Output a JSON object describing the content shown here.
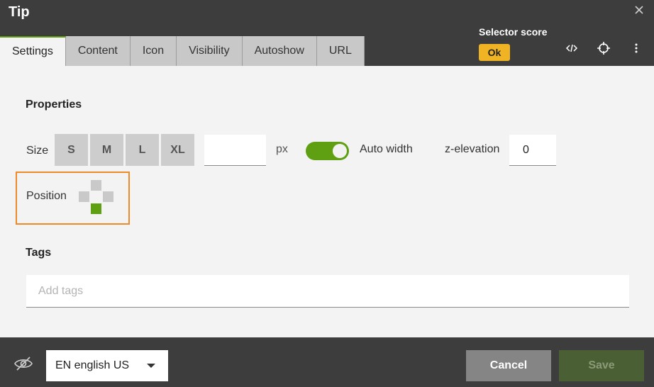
{
  "header": {
    "title": "Tip",
    "tabs": [
      {
        "label": "Settings",
        "active": true
      },
      {
        "label": "Content"
      },
      {
        "label": "Icon"
      },
      {
        "label": "Visibility"
      },
      {
        "label": "Autoshow"
      },
      {
        "label": "URL"
      }
    ],
    "selector_score_label": "Selector score",
    "selector_score_value": "Ok",
    "icons": [
      "close-icon",
      "code-icon",
      "crosshair-icon",
      "more-vertical-icon"
    ]
  },
  "properties": {
    "title": "Properties",
    "size_label": "Size",
    "sizes": [
      "S",
      "M",
      "L",
      "XL"
    ],
    "px_value": "",
    "px_unit": "px",
    "auto_width_label": "Auto width",
    "auto_width_on": true,
    "z_elevation_label": "z-elevation",
    "z_elevation_value": "0",
    "position_label": "Position",
    "position_selected": "bottom"
  },
  "tags": {
    "title": "Tags",
    "placeholder": "Add tags"
  },
  "footer": {
    "language": "EN english US",
    "cancel_label": "Cancel",
    "save_label": "Save"
  },
  "colors": {
    "accent_green": "#5fa012",
    "badge_yellow": "#f0b323",
    "highlight_orange": "#ef8a2b",
    "dark_bg": "#3d3d3d"
  }
}
